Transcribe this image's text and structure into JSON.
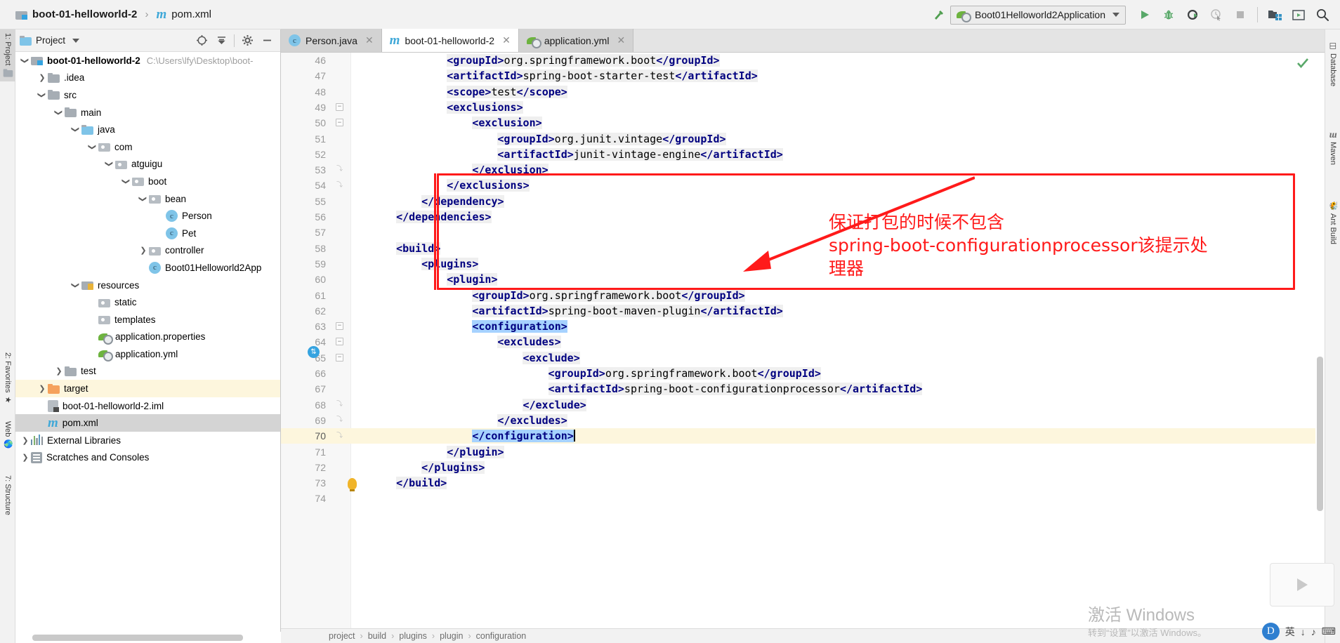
{
  "titlebar": {
    "project_name": "boot-01-helloworld-2",
    "separator": "›",
    "file_name": "pom.xml",
    "maven_glyph": "m"
  },
  "toolbar": {
    "run_config_name": "Boot01Helloworld2Application",
    "icons": [
      {
        "name": "build-hammer-icon",
        "glyph": "⚑"
      },
      {
        "name": "run-icon",
        "glyph": "▶"
      },
      {
        "name": "debug-icon",
        "glyph": "⚙"
      },
      {
        "name": "run-with-coverage-icon",
        "glyph": "◐"
      },
      {
        "name": "profiler-icon",
        "glyph": "◴"
      },
      {
        "name": "stop-icon",
        "glyph": "■"
      },
      {
        "name": "project-structure-icon",
        "glyph": "▓"
      },
      {
        "name": "updates-icon",
        "glyph": "▣"
      },
      {
        "name": "search-everywhere-icon",
        "glyph": "⚲"
      }
    ]
  },
  "left_strip": {
    "tabs": [
      {
        "label": "1: Project",
        "active": true
      },
      {
        "label": "2: Favorites",
        "active": false
      },
      {
        "label": "Web",
        "active": false
      },
      {
        "label": "7: Structure",
        "active": false
      }
    ]
  },
  "right_strip": {
    "tabs": [
      {
        "label": "Database"
      },
      {
        "label": "Maven"
      },
      {
        "label": "Ant Build"
      }
    ]
  },
  "project_panel": {
    "title": "Project",
    "header_icons": [
      "locate-icon",
      "collapse-all-icon",
      "settings-gear-icon",
      "hide-icon"
    ],
    "tree": [
      {
        "indent": 0,
        "twist": "d",
        "icon": "folder-module",
        "label": "boot-01-helloworld-2",
        "bold": true,
        "path": "C:\\Users\\lfy\\Desktop\\boot-",
        "state": "normal"
      },
      {
        "indent": 1,
        "twist": "r",
        "icon": "folder",
        "label": ".idea",
        "bold": false,
        "path": "",
        "state": "normal"
      },
      {
        "indent": 1,
        "twist": "d",
        "icon": "folder",
        "label": "src",
        "bold": false,
        "path": "",
        "state": "normal"
      },
      {
        "indent": 2,
        "twist": "d",
        "icon": "folder",
        "label": "main",
        "bold": false,
        "path": "",
        "state": "normal"
      },
      {
        "indent": 3,
        "twist": "d",
        "icon": "folder-source",
        "label": "java",
        "bold": false,
        "path": "",
        "state": "normal"
      },
      {
        "indent": 4,
        "twist": "d",
        "icon": "package",
        "label": "com",
        "bold": false,
        "path": "",
        "state": "normal"
      },
      {
        "indent": 5,
        "twist": "d",
        "icon": "package",
        "label": "atguigu",
        "bold": false,
        "path": "",
        "state": "normal"
      },
      {
        "indent": 6,
        "twist": "d",
        "icon": "package",
        "label": "boot",
        "bold": false,
        "path": "",
        "state": "normal"
      },
      {
        "indent": 7,
        "twist": "d",
        "icon": "package",
        "label": "bean",
        "bold": false,
        "path": "",
        "state": "normal"
      },
      {
        "indent": 8,
        "twist": "",
        "icon": "java-class",
        "label": "Person",
        "bold": false,
        "path": "",
        "state": "normal"
      },
      {
        "indent": 8,
        "twist": "",
        "icon": "java-class",
        "label": "Pet",
        "bold": false,
        "path": "",
        "state": "normal"
      },
      {
        "indent": 7,
        "twist": "r",
        "icon": "package",
        "label": "controller",
        "bold": false,
        "path": "",
        "state": "normal"
      },
      {
        "indent": 7,
        "twist": "",
        "icon": "spring-class",
        "label": "Boot01Helloworld2App",
        "bold": false,
        "path": "",
        "state": "normal"
      },
      {
        "indent": 3,
        "twist": "d",
        "icon": "folder-resources",
        "label": "resources",
        "bold": false,
        "path": "",
        "state": "normal"
      },
      {
        "indent": 4,
        "twist": "",
        "icon": "package",
        "label": "static",
        "bold": false,
        "path": "",
        "state": "normal"
      },
      {
        "indent": 4,
        "twist": "",
        "icon": "package",
        "label": "templates",
        "bold": false,
        "path": "",
        "state": "normal"
      },
      {
        "indent": 4,
        "twist": "",
        "icon": "spring-file",
        "label": "application.properties",
        "bold": false,
        "path": "",
        "state": "normal"
      },
      {
        "indent": 4,
        "twist": "",
        "icon": "spring-file",
        "label": "application.yml",
        "bold": false,
        "path": "",
        "state": "normal"
      },
      {
        "indent": 2,
        "twist": "r",
        "icon": "folder",
        "label": "test",
        "bold": false,
        "path": "",
        "state": "normal"
      },
      {
        "indent": 1,
        "twist": "r",
        "icon": "folder-excluded",
        "label": "target",
        "bold": false,
        "path": "",
        "state": "highlight"
      },
      {
        "indent": 1,
        "twist": "",
        "icon": "iml-file",
        "label": "boot-01-helloworld-2.iml",
        "bold": false,
        "path": "",
        "state": "normal"
      },
      {
        "indent": 1,
        "twist": "",
        "icon": "maven-file",
        "label": "pom.xml",
        "bold": false,
        "path": "",
        "state": "selected"
      },
      {
        "indent": 0,
        "twist": "r",
        "icon": "libraries",
        "label": "External Libraries",
        "bold": false,
        "path": "",
        "state": "normal"
      },
      {
        "indent": 0,
        "twist": "r",
        "icon": "scratches",
        "label": "Scratches and Consoles",
        "bold": false,
        "path": "",
        "state": "normal"
      }
    ]
  },
  "editor": {
    "tabs": [
      {
        "label": "Person.java",
        "icon": "java-class-icon",
        "active": false
      },
      {
        "label": "boot-01-helloworld-2",
        "icon": "maven-icon",
        "active": true
      },
      {
        "label": "application.yml",
        "icon": "spring-icon",
        "active": false
      }
    ],
    "first_line_number": 46,
    "cursor_line": 70,
    "lines": [
      {
        "n": 46,
        "indent": 12,
        "tokens": [
          {
            "t": "tag",
            "v": "<groupId>"
          },
          {
            "t": "txt",
            "v": "org.springframework.boot"
          },
          {
            "t": "tag",
            "v": "</groupId>"
          }
        ]
      },
      {
        "n": 47,
        "indent": 12,
        "tokens": [
          {
            "t": "tag",
            "v": "<artifactId>"
          },
          {
            "t": "txt",
            "v": "spring-boot-starter-test"
          },
          {
            "t": "tag",
            "v": "</artifactId>"
          }
        ]
      },
      {
        "n": 48,
        "indent": 12,
        "tokens": [
          {
            "t": "tag",
            "v": "<scope>"
          },
          {
            "t": "txt",
            "v": "test"
          },
          {
            "t": "tag",
            "v": "</scope>"
          }
        ]
      },
      {
        "n": 49,
        "indent": 12,
        "fold": "-",
        "tokens": [
          {
            "t": "tag",
            "v": "<exclusions>"
          }
        ]
      },
      {
        "n": 50,
        "indent": 16,
        "fold": "-",
        "tokens": [
          {
            "t": "tag",
            "v": "<exclusion>"
          }
        ]
      },
      {
        "n": 51,
        "indent": 20,
        "tokens": [
          {
            "t": "tag",
            "v": "<groupId>"
          },
          {
            "t": "txt",
            "v": "org.junit.vintage"
          },
          {
            "t": "tag",
            "v": "</groupId>"
          }
        ]
      },
      {
        "n": 52,
        "indent": 20,
        "tokens": [
          {
            "t": "tag",
            "v": "<artifactId>"
          },
          {
            "t": "txt",
            "v": "junit-vintage-engine"
          },
          {
            "t": "tag",
            "v": "</artifactId>"
          }
        ]
      },
      {
        "n": 53,
        "indent": 16,
        "fold": "^",
        "tokens": [
          {
            "t": "tag",
            "v": "</exclusion>"
          }
        ]
      },
      {
        "n": 54,
        "indent": 12,
        "fold": "^",
        "tokens": [
          {
            "t": "tag",
            "v": "</exclusions>"
          }
        ]
      },
      {
        "n": 55,
        "indent": 8,
        "tokens": [
          {
            "t": "tag",
            "v": "</dependency>"
          }
        ]
      },
      {
        "n": 56,
        "indent": 4,
        "tokens": [
          {
            "t": "tag",
            "v": "</dependencies>"
          }
        ]
      },
      {
        "n": 57,
        "indent": 0,
        "tokens": []
      },
      {
        "n": 58,
        "indent": 4,
        "tokens": [
          {
            "t": "tag",
            "v": "<build>"
          }
        ]
      },
      {
        "n": 59,
        "indent": 8,
        "tokens": [
          {
            "t": "tag",
            "v": "<plugins>"
          }
        ]
      },
      {
        "n": 60,
        "indent": 12,
        "tokens": [
          {
            "t": "tag",
            "v": "<plugin>"
          }
        ]
      },
      {
        "n": 61,
        "indent": 16,
        "tokens": [
          {
            "t": "tag",
            "v": "<groupId>"
          },
          {
            "t": "txt",
            "v": "org.springframework.boot"
          },
          {
            "t": "tag",
            "v": "</groupId>"
          }
        ]
      },
      {
        "n": 62,
        "indent": 16,
        "tokens": [
          {
            "t": "tag",
            "v": "<artifactId>"
          },
          {
            "t": "txt",
            "v": "spring-boot-maven-plugin"
          },
          {
            "t": "tag",
            "v": "</artifactId>"
          }
        ]
      },
      {
        "n": 63,
        "indent": 16,
        "fold": "-",
        "sel": true,
        "tokens": [
          {
            "t": "tag",
            "v": "<configuration>"
          }
        ]
      },
      {
        "n": 64,
        "indent": 20,
        "fold": "-",
        "tokens": [
          {
            "t": "tag",
            "v": "<excludes>"
          }
        ]
      },
      {
        "n": 65,
        "indent": 24,
        "fold": "-",
        "tokens": [
          {
            "t": "tag",
            "v": "<exclude>"
          }
        ]
      },
      {
        "n": 66,
        "indent": 28,
        "tokens": [
          {
            "t": "tag",
            "v": "<groupId>"
          },
          {
            "t": "txt",
            "v": "org.springframework.boot"
          },
          {
            "t": "tag",
            "v": "</groupId>"
          }
        ]
      },
      {
        "n": 67,
        "indent": 28,
        "tokens": [
          {
            "t": "tag",
            "v": "<artifactId>"
          },
          {
            "t": "txt",
            "v": "spring-boot-configurationprocessor"
          },
          {
            "t": "tag",
            "v": "</artifactId>"
          }
        ]
      },
      {
        "n": 68,
        "indent": 24,
        "fold": "^",
        "tokens": [
          {
            "t": "tag",
            "v": "</exclude>"
          }
        ]
      },
      {
        "n": 69,
        "indent": 20,
        "fold": "^",
        "tokens": [
          {
            "t": "tag",
            "v": "</excludes>"
          }
        ]
      },
      {
        "n": 70,
        "indent": 16,
        "fold": "^",
        "sel": true,
        "cursor": true,
        "tokens": [
          {
            "t": "tag",
            "v": "</configuration>"
          }
        ]
      },
      {
        "n": 71,
        "indent": 12,
        "tokens": [
          {
            "t": "tag",
            "v": "</plugin>"
          }
        ]
      },
      {
        "n": 72,
        "indent": 8,
        "tokens": [
          {
            "t": "tag",
            "v": "</plugins>"
          }
        ]
      },
      {
        "n": 73,
        "indent": 4,
        "tokens": [
          {
            "t": "tag",
            "v": "</build>"
          }
        ]
      },
      {
        "n": 74,
        "indent": 0,
        "tokens": []
      }
    ],
    "breadcrumb": [
      "project",
      "build",
      "plugins",
      "plugin",
      "configuration"
    ],
    "breadcrumb_sep": "›"
  },
  "annotation": {
    "text": "保证打包的时候不包含\nspring-boot-configurationprocessor该提示处\n理器",
    "color": "#ff1a1a"
  },
  "watermark": {
    "line1": "激活 Windows",
    "line2": "转到“设置”以激活 Windows。"
  },
  "ime": {
    "lang": "英",
    "items": [
      "↓",
      "♪",
      "⌨"
    ]
  },
  "colors": {
    "accent_red": "#ff1a1a",
    "selection_blue": "#a6d2ff",
    "tag_navy": "#000080",
    "highlight_yellow": "#fdf6dd",
    "spring_green": "#6db33f"
  }
}
